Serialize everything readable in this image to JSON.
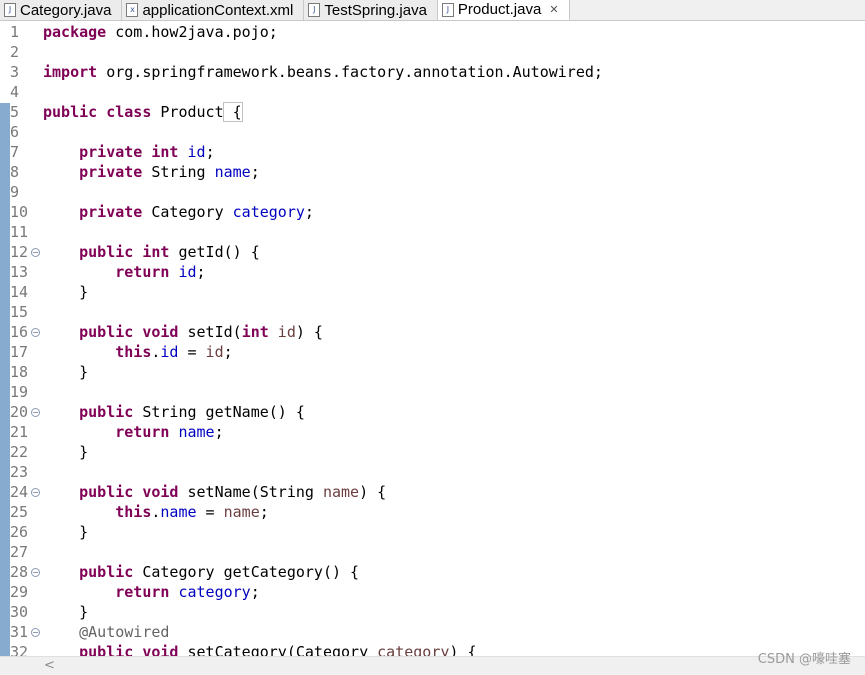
{
  "tabs": [
    {
      "label": "Category.java",
      "icon": "java-file-icon",
      "glyph": "J",
      "active": false
    },
    {
      "label": "applicationContext.xml",
      "icon": "xml-file-icon",
      "glyph": "x",
      "active": false
    },
    {
      "label": "TestSpring.java",
      "icon": "java-file-icon",
      "glyph": "J",
      "active": false
    },
    {
      "label": "Product.java",
      "icon": "java-file-icon",
      "glyph": "J",
      "active": true,
      "close": "✕"
    }
  ],
  "editor": {
    "lines": [
      {
        "num": "1",
        "fold": false,
        "tokens": [
          [
            "kw",
            "package"
          ],
          [
            "",
            "com.how2java.pojo;"
          ]
        ]
      },
      {
        "num": "2",
        "fold": false,
        "tokens": []
      },
      {
        "num": "3",
        "fold": false,
        "tokens": [
          [
            "kw",
            "import"
          ],
          [
            "",
            "org.springframework.beans.factory.annotation.Autowired;"
          ]
        ]
      },
      {
        "num": "4",
        "fold": false,
        "tokens": []
      },
      {
        "num": "5",
        "fold": false,
        "tokens": [
          [
            "kw",
            "public"
          ],
          [
            "kw",
            "class"
          ],
          [
            "",
            "Product"
          ],
          [
            "brk",
            "{"
          ]
        ]
      },
      {
        "num": "6",
        "fold": false,
        "tokens": []
      },
      {
        "num": "7",
        "fold": false,
        "tokens": [
          [
            "",
            "    "
          ],
          [
            "kw",
            "private"
          ],
          [
            "kw",
            "int"
          ],
          [
            "fld",
            "id"
          ],
          [
            "",
            ";"
          ]
        ]
      },
      {
        "num": "8",
        "fold": false,
        "tokens": [
          [
            "",
            "    "
          ],
          [
            "kw",
            "private"
          ],
          [
            "",
            "String"
          ],
          [
            "fld",
            "name"
          ],
          [
            "",
            ";"
          ]
        ]
      },
      {
        "num": "9",
        "fold": false,
        "tokens": []
      },
      {
        "num": "10",
        "fold": false,
        "tokens": [
          [
            "",
            "    "
          ],
          [
            "kw",
            "private"
          ],
          [
            "",
            "Category"
          ],
          [
            "fld",
            "category"
          ],
          [
            "",
            ";"
          ]
        ]
      },
      {
        "num": "11",
        "fold": false,
        "tokens": []
      },
      {
        "num": "12",
        "fold": true,
        "tokens": [
          [
            "",
            "    "
          ],
          [
            "kw",
            "public"
          ],
          [
            "kw",
            "int"
          ],
          [
            "",
            "getId() {"
          ]
        ]
      },
      {
        "num": "13",
        "fold": false,
        "tokens": [
          [
            "",
            "        "
          ],
          [
            "kw",
            "return"
          ],
          [
            "fld",
            "id"
          ],
          [
            "",
            ";"
          ]
        ]
      },
      {
        "num": "14",
        "fold": false,
        "tokens": [
          [
            "",
            "    }"
          ]
        ]
      },
      {
        "num": "15",
        "fold": false,
        "tokens": []
      },
      {
        "num": "16",
        "fold": true,
        "tokens": [
          [
            "",
            "    "
          ],
          [
            "kw",
            "public"
          ],
          [
            "kw",
            "void"
          ],
          [
            "",
            "setId("
          ],
          [
            "kw",
            "int"
          ],
          [
            "prm",
            "id"
          ],
          [
            "",
            ") {"
          ]
        ]
      },
      {
        "num": "17",
        "fold": false,
        "tokens": [
          [
            "",
            "        "
          ],
          [
            "kw",
            "this"
          ],
          [
            "",
            "."
          ],
          [
            "fld",
            "id"
          ],
          [
            "",
            "="
          ],
          [
            "prm",
            "id"
          ],
          [
            "",
            ";"
          ]
        ]
      },
      {
        "num": "18",
        "fold": false,
        "tokens": [
          [
            "",
            "    }"
          ]
        ]
      },
      {
        "num": "19",
        "fold": false,
        "tokens": []
      },
      {
        "num": "20",
        "fold": true,
        "tokens": [
          [
            "",
            "    "
          ],
          [
            "kw",
            "public"
          ],
          [
            "",
            "String getName() {"
          ]
        ]
      },
      {
        "num": "21",
        "fold": false,
        "tokens": [
          [
            "",
            "        "
          ],
          [
            "kw",
            "return"
          ],
          [
            "fld",
            "name"
          ],
          [
            "",
            ";"
          ]
        ]
      },
      {
        "num": "22",
        "fold": false,
        "tokens": [
          [
            "",
            "    }"
          ]
        ]
      },
      {
        "num": "23",
        "fold": false,
        "tokens": []
      },
      {
        "num": "24",
        "fold": true,
        "tokens": [
          [
            "",
            "    "
          ],
          [
            "kw",
            "public"
          ],
          [
            "kw",
            "void"
          ],
          [
            "",
            "setName(String"
          ],
          [
            "prm",
            "name"
          ],
          [
            "",
            ") {"
          ]
        ]
      },
      {
        "num": "25",
        "fold": false,
        "tokens": [
          [
            "",
            "        "
          ],
          [
            "kw",
            "this"
          ],
          [
            "",
            "."
          ],
          [
            "fld",
            "name"
          ],
          [
            "",
            "="
          ],
          [
            "prm",
            "name"
          ],
          [
            "",
            ";"
          ]
        ]
      },
      {
        "num": "26",
        "fold": false,
        "tokens": [
          [
            "",
            "    }"
          ]
        ]
      },
      {
        "num": "27",
        "fold": false,
        "tokens": []
      },
      {
        "num": "28",
        "fold": true,
        "tokens": [
          [
            "",
            "    "
          ],
          [
            "kw",
            "public"
          ],
          [
            "",
            "Category getCategory() {"
          ]
        ]
      },
      {
        "num": "29",
        "fold": false,
        "tokens": [
          [
            "",
            "        "
          ],
          [
            "kw",
            "return"
          ],
          [
            "fld",
            "category"
          ],
          [
            "",
            ";"
          ]
        ]
      },
      {
        "num": "30",
        "fold": false,
        "tokens": [
          [
            "",
            "    }"
          ]
        ]
      },
      {
        "num": "31",
        "fold": true,
        "tokens": [
          [
            "",
            "    "
          ],
          [
            "ann",
            "@Autowired"
          ]
        ]
      },
      {
        "num": "32",
        "fold": false,
        "tokens": [
          [
            "",
            "    "
          ],
          [
            "kw",
            "public"
          ],
          [
            "kw",
            "void"
          ],
          [
            "",
            "setCategory(Category"
          ],
          [
            "prm",
            "category"
          ],
          [
            "",
            ") {"
          ]
        ]
      }
    ]
  },
  "scrollbar": {
    "left_arrow": "<"
  },
  "watermark": "CSDN @嚎哇塞"
}
